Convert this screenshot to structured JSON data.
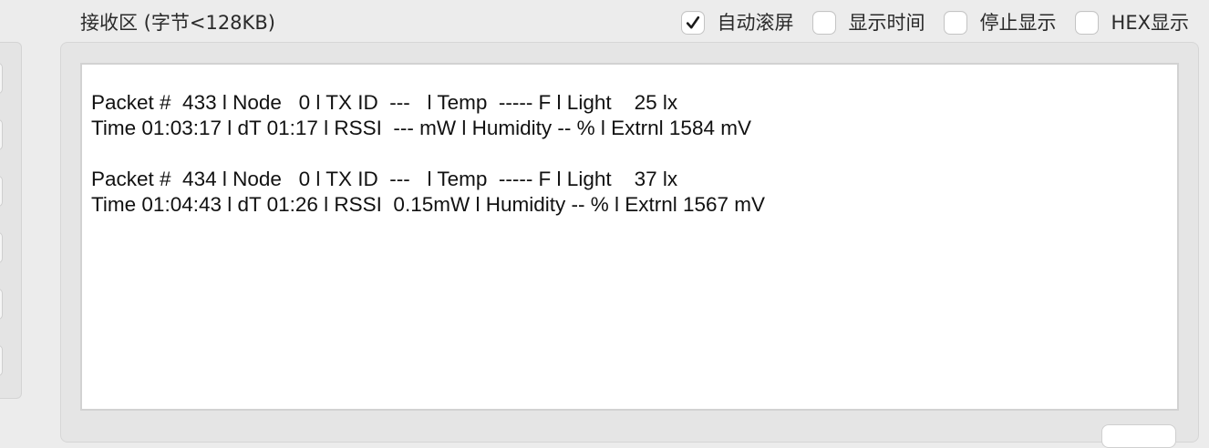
{
  "receive": {
    "title": "接收区 (字节<128KB)",
    "options": [
      {
        "label": "自动滚屏",
        "checked": true
      },
      {
        "label": "显示时间",
        "checked": false
      },
      {
        "label": "停止显示",
        "checked": false
      },
      {
        "label": "HEX显示",
        "checked": false
      }
    ],
    "lines": [
      "Packet #  433 l Node   0 l TX ID  ---   l Temp  ----- F l Light    25 lx",
      "Time 01:03:17 l dT 01:17 l RSSI  --- mW l Humidity -- % l Extrnl 1584 mV",
      "",
      "Packet #  434 l Node   0 l TX ID  ---   l Temp  ----- F l Light    37 lx",
      "Time 01:04:43 l dT 01:26 l RSSI  0.15mW l Humidity -- % l Extrnl 1567 mV"
    ]
  },
  "icons": {
    "checkmark": "checkmark-icon"
  }
}
